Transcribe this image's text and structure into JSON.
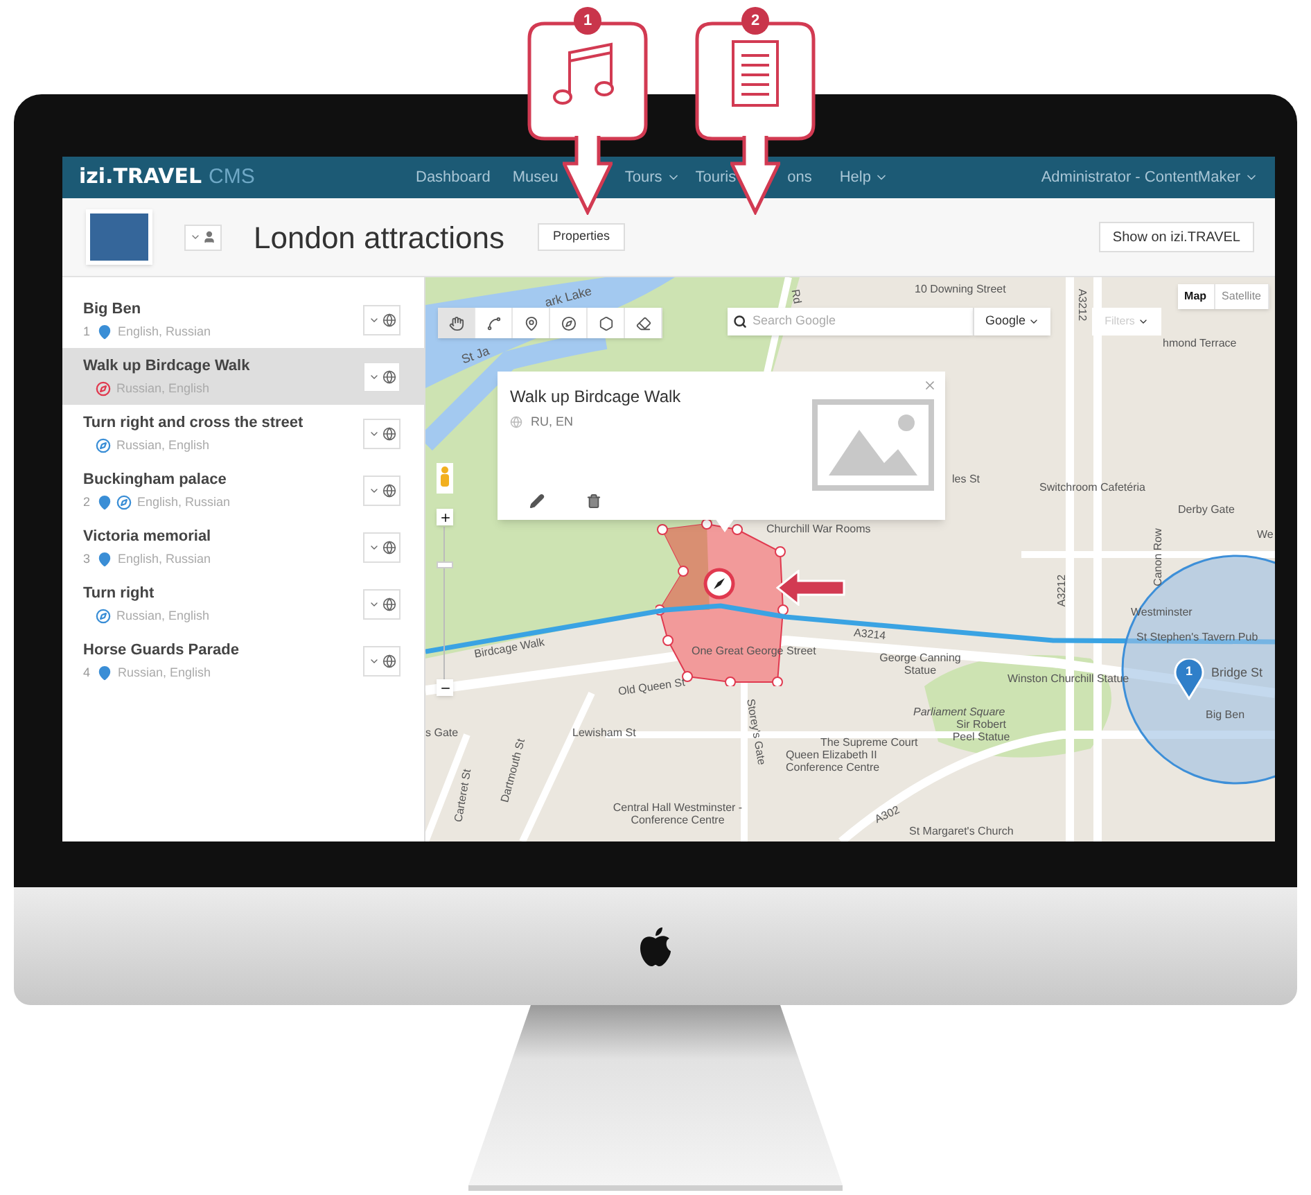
{
  "callouts": [
    {
      "number": "1",
      "kind": "audio"
    },
    {
      "number": "2",
      "kind": "text"
    }
  ],
  "navbar": {
    "brand": "izi.TRAVEL",
    "product": "CMS",
    "user": "Administrator - ContentMaker",
    "items": [
      {
        "label": "Dashboard",
        "dropdown": false
      },
      {
        "label": "Museu",
        "dropdown": false
      },
      {
        "label": "Tours",
        "dropdown": true
      },
      {
        "label": "Touris",
        "dropdown": false
      },
      {
        "label": "ons",
        "dropdown": false
      },
      {
        "label": "Help",
        "dropdown": true
      }
    ]
  },
  "header": {
    "title": "London attractions",
    "properties_button": "Properties",
    "show_button": "Show on izi.TRAVEL"
  },
  "sidebar": {
    "items": [
      {
        "title": "Big Ben",
        "number": "1",
        "markers": [
          {
            "kind": "pin"
          }
        ],
        "languages": "English, Russian",
        "selected": false
      },
      {
        "title": "Walk up Birdcage Walk",
        "markers": [
          {
            "kind": "compass",
            "color": "#e0394f"
          }
        ],
        "languages": "Russian, English",
        "selected": true
      },
      {
        "title": "Turn right and cross the street",
        "markers": [
          {
            "kind": "compass",
            "color": "#3a8ed6"
          }
        ],
        "languages": "Russian, English",
        "selected": false
      },
      {
        "title": "Buckingham palace",
        "number": "2",
        "markers": [
          {
            "kind": "pin"
          },
          {
            "kind": "compass",
            "color": "#3a8ed6"
          }
        ],
        "languages": "English, Russian",
        "selected": false
      },
      {
        "title": "Victoria memorial",
        "number": "3",
        "markers": [
          {
            "kind": "pin"
          }
        ],
        "languages": "English, Russian",
        "selected": false
      },
      {
        "title": "Turn right",
        "markers": [
          {
            "kind": "compass",
            "color": "#3a8ed6"
          }
        ],
        "languages": "Russian, English",
        "selected": false
      },
      {
        "title": "Horse Guards Parade",
        "number": "4",
        "markers": [
          {
            "kind": "pin"
          }
        ],
        "languages": "Russian, English",
        "selected": false
      }
    ]
  },
  "map": {
    "search_placeholder": "Search Google",
    "engine_button": "Google",
    "filters_button": "Filters",
    "map_types": [
      {
        "label": "Map",
        "selected": true
      },
      {
        "label": "Satellite",
        "selected": false
      }
    ],
    "tools": [
      {
        "kind": "hand",
        "selected": true
      },
      {
        "kind": "polyline",
        "selected": false
      },
      {
        "kind": "pin",
        "selected": false
      },
      {
        "kind": "compass",
        "selected": false
      },
      {
        "kind": "polygon",
        "selected": false
      },
      {
        "kind": "eraser",
        "selected": false
      }
    ],
    "popup": {
      "title": "Walk up Birdcage Walk",
      "languages": "RU, EN"
    },
    "route_marker": "1",
    "labels": [
      "ark Lake",
      "St Ja",
      "Rd",
      "10 Downing Street",
      "A3212",
      "hmond Terrace",
      "Churchill War Rooms",
      "les St",
      "Switchroom Cafetéria",
      "Derby Gate",
      "Canon Row",
      "A3212",
      "Westminster",
      "St Stephen's Tavern Pub",
      "Bridge St",
      "Big Ben",
      "Winston Churchill Statue",
      "George Canning Statue",
      "Parliament Square",
      "The Supreme Court",
      "Sir Robert Peel Statue",
      "Queen Elizabeth II Conference Centre",
      "Central Hall Westminster - Conference Centre",
      "St Margaret's Church",
      "A302",
      "A3214",
      "One Great George Street",
      "Old Queen St",
      "s Gate",
      "Lewisham St",
      "Storey's Gate",
      "Dartmouth St",
      "Carteret St",
      "Birdcage Walk",
      "We"
    ]
  }
}
